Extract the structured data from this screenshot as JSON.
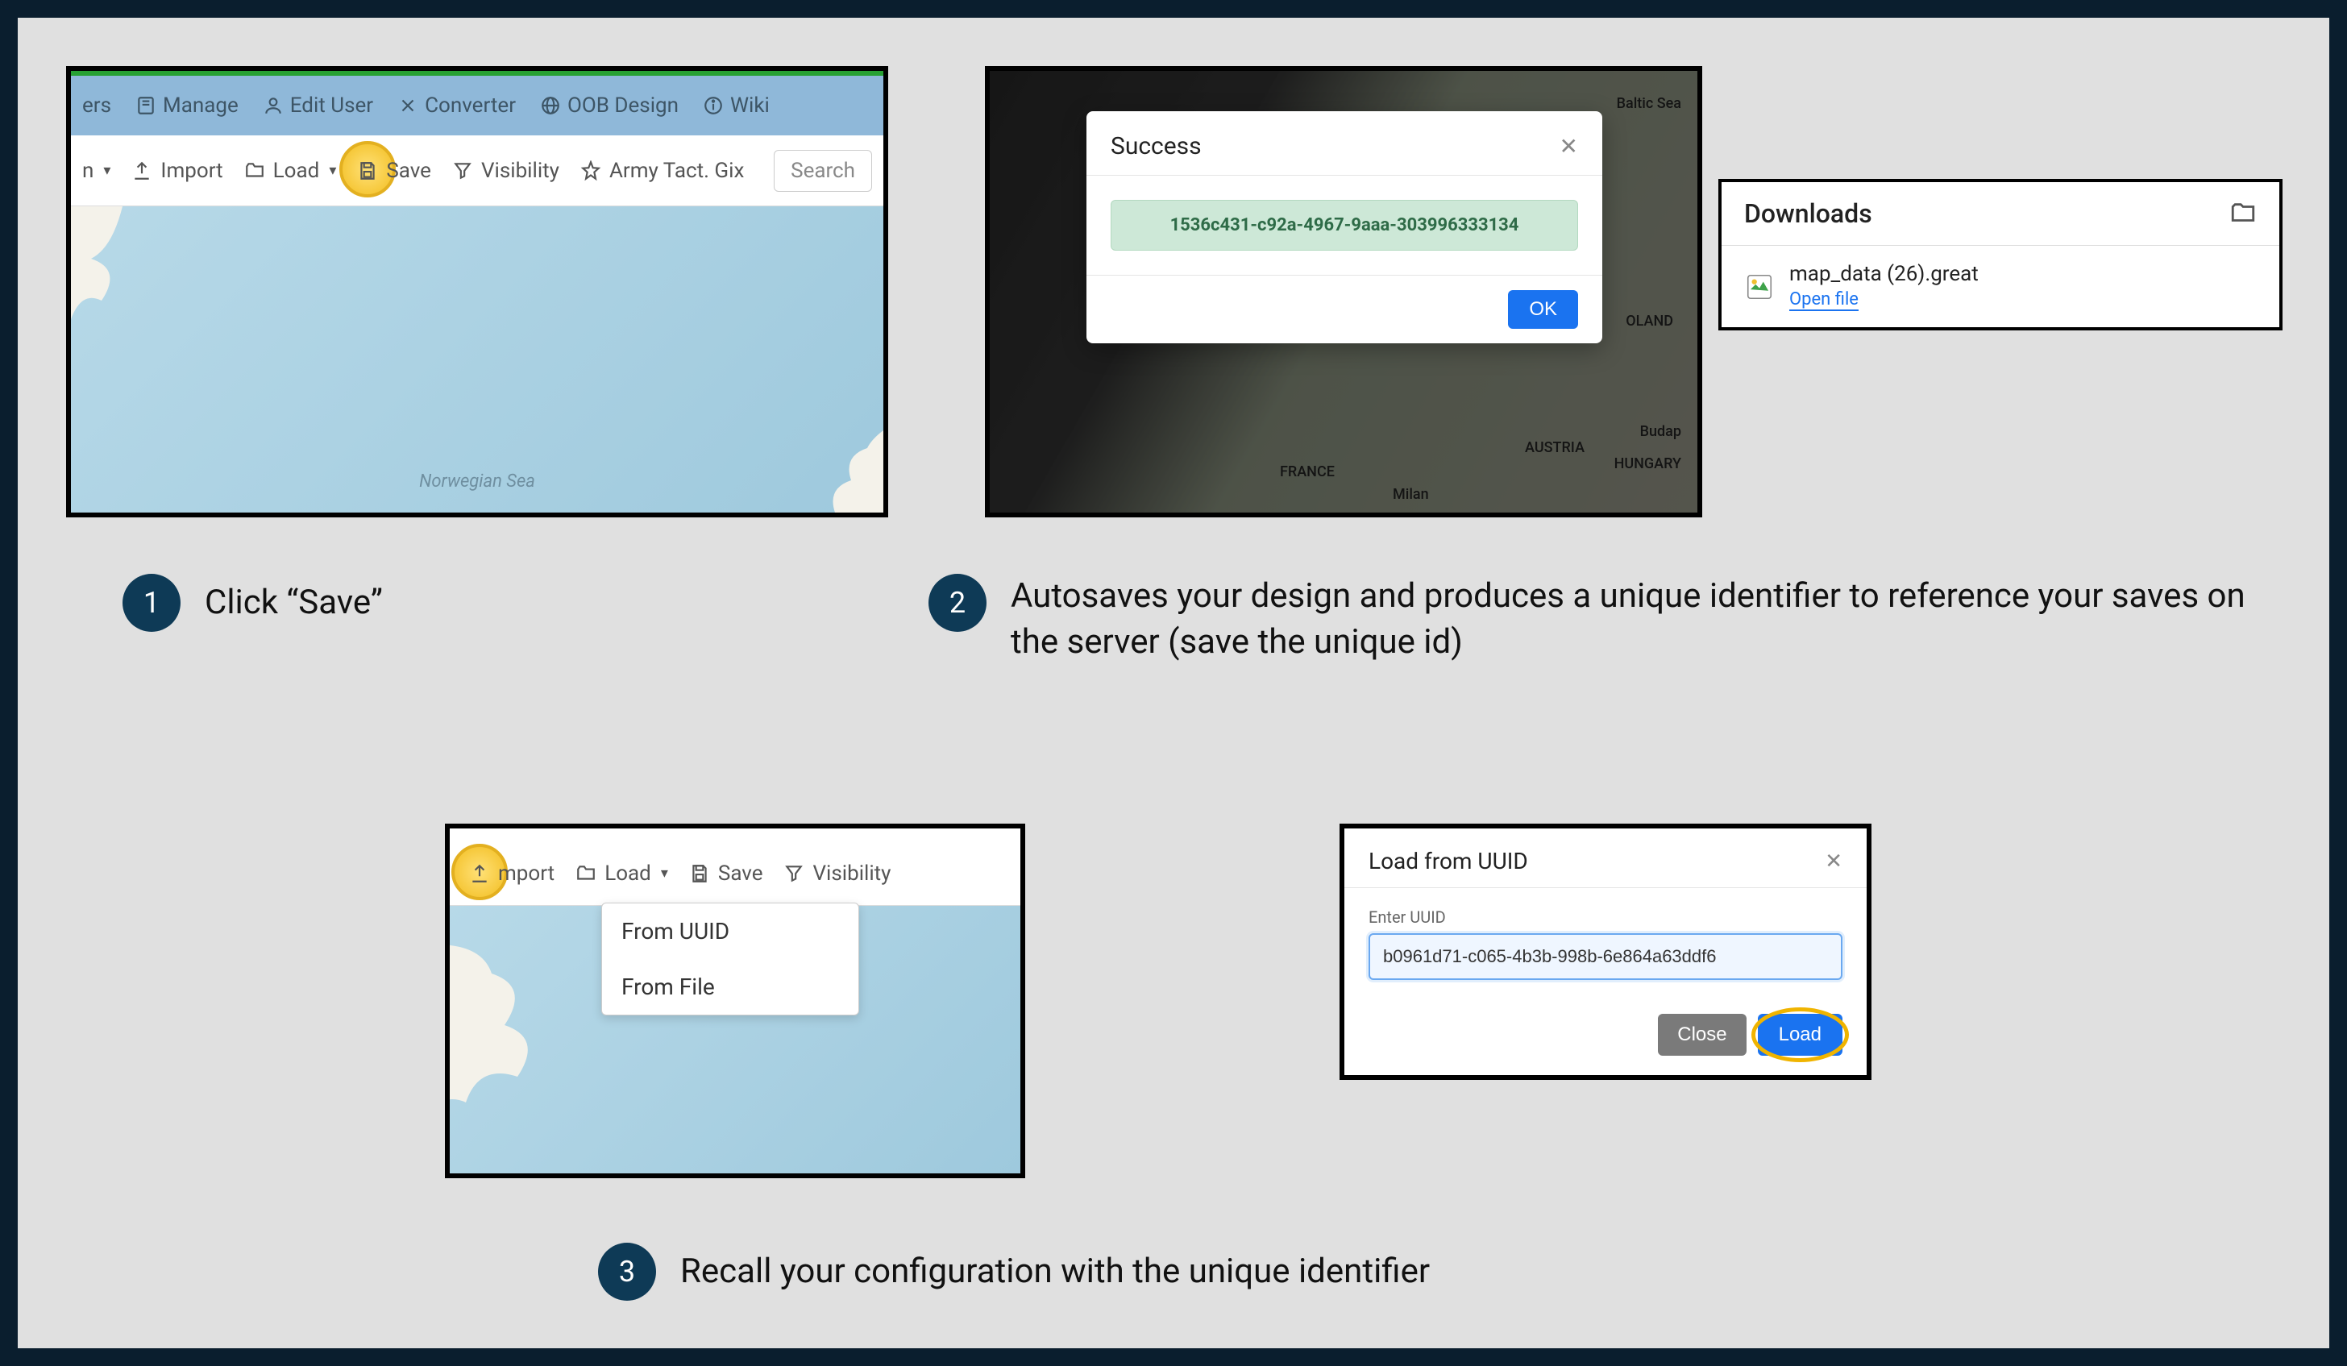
{
  "steps": {
    "s1": {
      "num": "1",
      "text": "Click “Save”"
    },
    "s2": {
      "num": "2",
      "text": "Autosaves your design and produces a unique identifier to reference your saves on the server (save the unique id)"
    },
    "s3": {
      "num": "3",
      "text": "Recall your configuration with the unique identifier"
    }
  },
  "panel1": {
    "menu": {
      "ers": "ers",
      "manage": "Manage",
      "edit_user": "Edit User",
      "converter": "Converter",
      "oob": "OOB Design",
      "wiki": "Wiki"
    },
    "toolbar": {
      "chev": "▾",
      "import": "Import",
      "load": "Load",
      "save": "Save",
      "visibility": "Visibility",
      "army": "Army Tact. Gix"
    },
    "search_placeholder": "Search",
    "sea_label": "Norwegian Sea"
  },
  "panel2": {
    "modal_title": "Success",
    "uuid": "1536c431-c92a-4967-9aaa-303996333134",
    "ok": "OK",
    "map_labels": {
      "baltic": "Baltic Sea",
      "poland": "OLAND",
      "france": "FRANCE",
      "hungary": "HUNGARY",
      "budapest": "Budap",
      "milan": "Milan",
      "austria": "AUSTRIA"
    }
  },
  "downloads": {
    "title": "Downloads",
    "file": "map_data (26).great",
    "open": "Open file"
  },
  "panel3": {
    "toolbar": {
      "import": "mport",
      "load": "Load",
      "save": "Save",
      "visibility": "Visibility"
    },
    "dropdown": {
      "uuid": "From UUID",
      "file": "From File"
    }
  },
  "panel4": {
    "title": "Load from UUID",
    "label": "Enter UUID",
    "value": "b0961d71-c065-4b3b-998b-6e864a63ddf6",
    "close": "Close",
    "load": "Load"
  }
}
